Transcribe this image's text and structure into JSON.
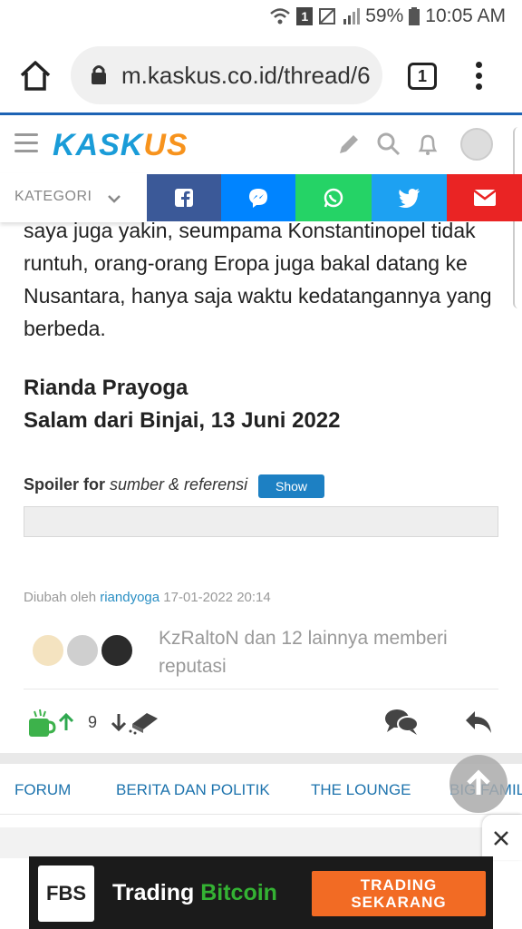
{
  "status_bar": {
    "battery": "59%",
    "time": "10:05 AM",
    "notif": "1"
  },
  "browser": {
    "url": "m.kaskus.co.id/thread/6",
    "tab_count": "1"
  },
  "header": {
    "logo_left": "KASK",
    "logo_right": "US"
  },
  "kategori": {
    "label": "KATEGORI"
  },
  "share": {
    "facebook_color": "#3b5998",
    "messenger_color": "#0084ff",
    "whatsapp_color": "#25d366",
    "twitter_color": "#1da1f2",
    "email_color": "#ea2424"
  },
  "post": {
    "paragraph": "saya juga yakin, seumpama Konstantinopel tidak runtuh, orang-orang Eropa juga bakal datang ke Nusantara, hanya saja waktu kedatangannya yang berbeda.",
    "author_name": "Rianda Prayoga",
    "greeting": "Salam dari Binjai, 13 Juni 2022",
    "spoiler_label": "Spoiler for",
    "spoiler_title": "sumber & referensi",
    "spoiler_button": "Show",
    "edited_prefix": "Diubah oleh",
    "edited_user": "riandyoga",
    "edited_time": "17-01-2022 20:14",
    "reputation_text": "KzRaltoN dan 12 lainnya memberi reputasi",
    "vote_score": "9"
  },
  "bottom_nav": {
    "items": [
      "FORUM",
      "BERITA DAN POLITIK",
      "THE LOUNGE",
      "BIG FAMIL"
    ]
  },
  "ad": {
    "brand": "FBS",
    "text_white": "Trading ",
    "text_green": "Bitcoin",
    "cta_line1": "TRADING",
    "cta_line2": "SEKARANG"
  }
}
